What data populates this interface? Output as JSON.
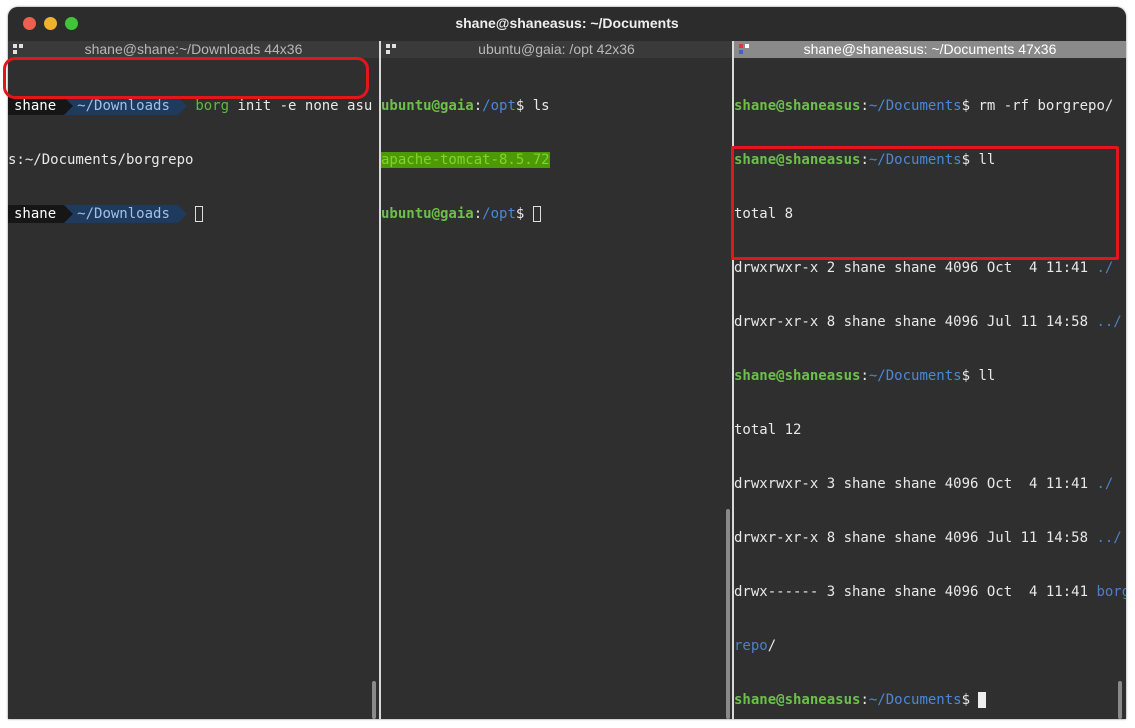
{
  "window": {
    "title": "shane@shaneasus: ~/Documents"
  },
  "colors": {
    "annotation": "#e3161c",
    "prompt_green": "#5fb84a",
    "prompt_blue": "#4d7fc9",
    "pane_active_header": "#8a8a8a"
  },
  "pane1": {
    "header": "shane@shane:~/Downloads 44x36",
    "line1": {
      "user": "shane",
      "dir": "~/Downloads",
      "cmd": "borg",
      "args": " init -e none asu"
    },
    "line2": "s:~/Documents/borgrepo",
    "line3": {
      "user": "shane",
      "dir": "~/Downloads"
    }
  },
  "pane2": {
    "header": "ubuntu@gaia: /opt 42x36",
    "line1": {
      "user": "ubuntu@gaia",
      "sep": ":",
      "path": "/opt",
      "dollar": "$ ",
      "cmd": "ls"
    },
    "line2": "apache-tomcat-8.5.72",
    "line3": {
      "user": "ubuntu@gaia",
      "sep": ":",
      "path": "/opt",
      "dollar": "$ "
    }
  },
  "pane3": {
    "header": "shane@shaneasus: ~/Documents 47x36",
    "prompt": {
      "user": "shane@shaneasus",
      "sep": ":",
      "path": "~/Documents",
      "dollar": "$ "
    },
    "cmd1": "rm -rf borgrepo/",
    "cmd2": "ll",
    "out1": [
      "total 8"
    ],
    "out1_dirs": [
      {
        "text": "drwxrwxr-x 2 shane shane 4096 Oct  4 11:41 ",
        "name": "./"
      },
      {
        "text": "drwxr-xr-x 8 shane shane 4096 Jul 11 14:58 ",
        "name": "../"
      }
    ],
    "cmd3": "ll",
    "out2_total": "total 12",
    "out2_dirs": [
      {
        "text": "drwxrwxr-x 3 shane shane 4096 Oct  4 11:41 ",
        "name": "./"
      },
      {
        "text": "drwxr-xr-x 8 shane shane 4096 Jul 11 14:58 ",
        "name": "../"
      },
      {
        "text": "drwx------ 3 shane shane 4096 Oct  4 11:41 ",
        "name": "borg"
      }
    ],
    "wrap": {
      "name": "repo",
      "slash": "/"
    }
  }
}
